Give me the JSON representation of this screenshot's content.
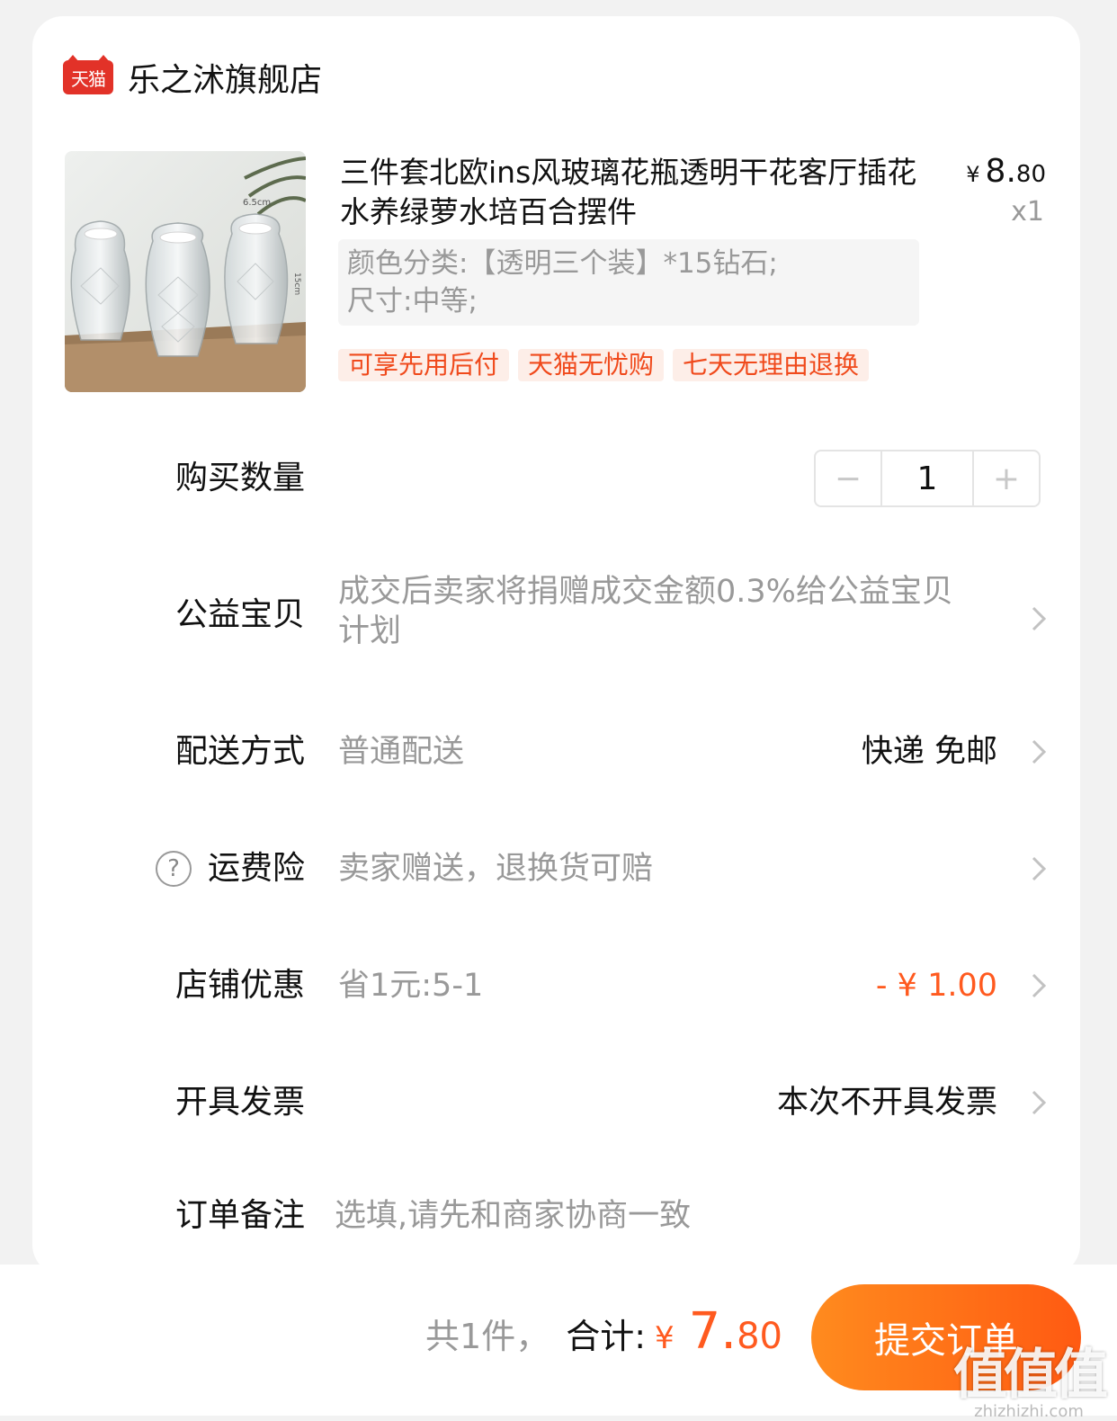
{
  "store": {
    "name": "乐之沭旗舰店",
    "platform_badge": "天猫"
  },
  "product": {
    "title": "三件套北欧ins风玻璃花瓶透明干花客厅插花水养绿萝水培百合摆件",
    "price_symbol": "¥",
    "price_int": "8.",
    "price_dec": "80",
    "quantity_label": "x1",
    "sku_line1": "颜色分类:【透明三个装】*15钻石;",
    "sku_line2": "尺寸:中等;",
    "tags": [
      "可享先用后付",
      "天猫无忧购",
      "七天无理由退换"
    ],
    "image_marks": [
      "6.5cm",
      "15cm"
    ]
  },
  "quantity": {
    "label": "购买数量",
    "value": "1",
    "minus": "−",
    "plus": "+"
  },
  "rows": {
    "charity": {
      "label": "公益宝贝",
      "value": "成交后卖家将捐赠成交金额0.3%给公益宝贝计划"
    },
    "delivery": {
      "label": "配送方式",
      "value": "普通配送",
      "right": "快递 免邮"
    },
    "shipping_insurance": {
      "label": "运费险",
      "value": "卖家赠送，退换货可赔",
      "help_icon": "?"
    },
    "store_discount": {
      "label": "店铺优惠",
      "value": "省1元:5-1",
      "right": "- ¥ 1.00"
    },
    "invoice": {
      "label": "开具发票",
      "right": "本次不开具发票"
    },
    "remark": {
      "label": "订单备注",
      "placeholder": "选填,请先和商家协商一致"
    }
  },
  "footer": {
    "count_text": "共1件，",
    "total_label": "合计:",
    "total_symbol": "¥",
    "total_int": "7.",
    "total_dec": "80",
    "submit_label": "提交订单"
  },
  "watermark": {
    "mark": "值值值",
    "url": "zhizhizhi.com"
  },
  "colors": {
    "accent": "#ff5a1f",
    "tmall_red": "#e23228",
    "tag_bg": "#fdeee8",
    "muted": "#999999"
  }
}
